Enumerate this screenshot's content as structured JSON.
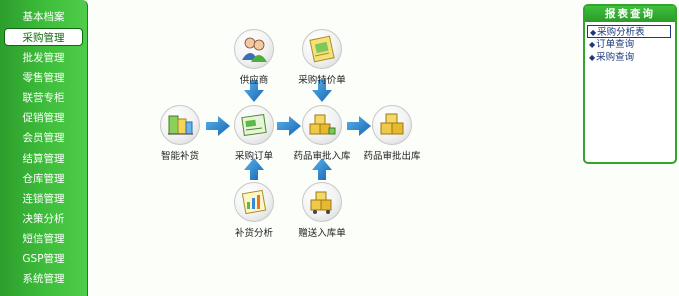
{
  "sidebar": {
    "title": "基本档案",
    "items": [
      {
        "label": "采购管理",
        "active": true
      },
      {
        "label": "批发管理"
      },
      {
        "label": "零售管理"
      },
      {
        "label": "联营专柜"
      },
      {
        "label": "促销管理"
      },
      {
        "label": "会员管理"
      },
      {
        "label": "结算管理"
      },
      {
        "label": "仓库管理"
      },
      {
        "label": "连锁管理"
      },
      {
        "label": "决策分析"
      },
      {
        "label": "短信管理"
      },
      {
        "label": "GSP管理"
      },
      {
        "label": "系统管理"
      }
    ]
  },
  "flow": {
    "nodes": {
      "supplier": "供应商",
      "special_price_order": "采购特价单",
      "smart_restock": "智能补货",
      "purchase_order": "采购订单",
      "drug_approve_in": "药品审批入库",
      "drug_approve_out": "药品审批出库",
      "restock_analysis": "补货分析",
      "transfer_in_order": "赠送入库单"
    },
    "colors": {
      "arrow": "#1e7fc8"
    }
  },
  "report": {
    "title": "报表查询",
    "items": [
      "采购分析表",
      "订单查询",
      "采购查询"
    ]
  }
}
